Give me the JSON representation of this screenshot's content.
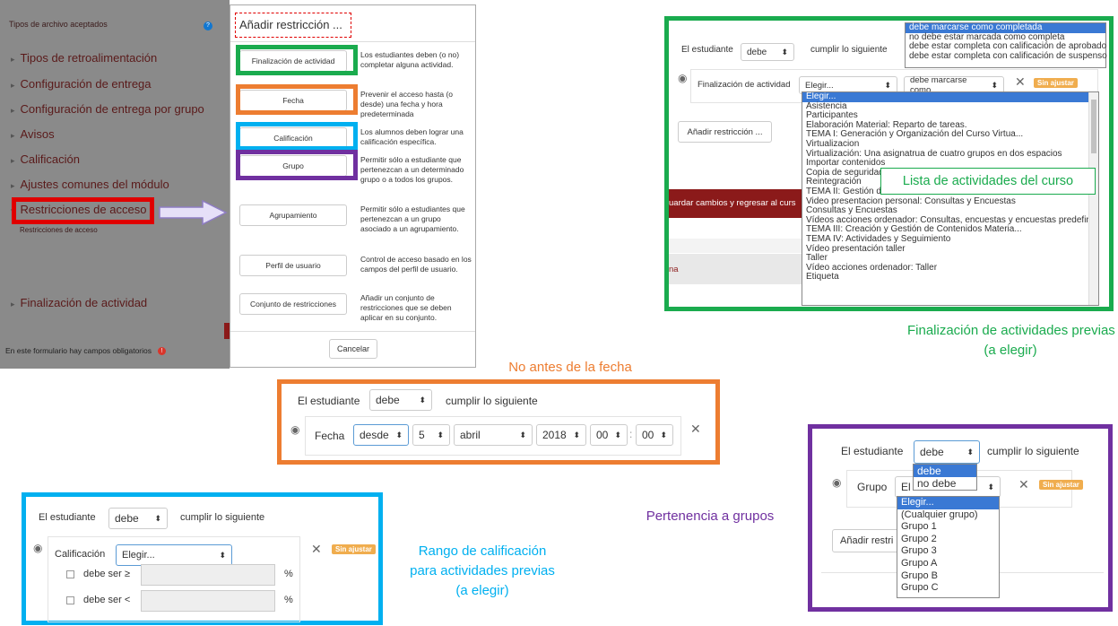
{
  "settings": {
    "tipos_label": "Tipos de archivo aceptados",
    "nav": [
      "Tipos de retroalimentación",
      "Configuración de entrega",
      "Configuración de entrega por grupo",
      "Avisos",
      "Calificación",
      "Ajustes comunes del módulo",
      "Restricciones de acceso",
      "Finalización de actividad"
    ],
    "sub_label": "Restricciones de acceso",
    "footer_note": "En este formulario hay campos obligatorios"
  },
  "modal": {
    "title": "Añadir restricción ...",
    "options": [
      {
        "label": "Finalización de actividad",
        "desc": "Los estudiantes deben (o no) completar alguna actividad."
      },
      {
        "label": "Fecha",
        "desc": "Prevenir el acceso hasta (o desde) una fecha y hora predeterminada"
      },
      {
        "label": "Calificación",
        "desc": "Los alumnos deben lograr una calificación específica."
      },
      {
        "label": "Grupo",
        "desc": "Permitir sólo a estudiante que pertenezcan a un determinado grupo o a todos los grupos."
      },
      {
        "label": "Agrupamiento",
        "desc": "Permitir sólo a estudiantes que pertenezcan a un grupo asociado a un agrupamiento."
      },
      {
        "label": "Perfil de usuario",
        "desc": "Control de acceso basado en los campos del perfil de usuario."
      },
      {
        "label": "Conjunto de restricciones",
        "desc": "Añadir un conjunto de restricciones que se deben aplicar en su conjunto."
      }
    ],
    "cancel": "Cancelar"
  },
  "completion": {
    "el_estudiante": "El estudiante",
    "debe": "debe",
    "cumplir": "cumplir lo siguiente",
    "row_label": "Finalización de actividad",
    "elegir": "Elegir...",
    "marcarse": "debe marcarse como",
    "sin_ajustar": "Sin ajustar",
    "add_btn": "Añadir restricción ...",
    "save_btn": "uardar cambios y regresar al curs",
    "stray": "na",
    "options": [
      "debe marcarse como completada",
      "no debe estar marcada como completa",
      "debe estar completa con calificación de aprobado",
      "debe estar completa con calificación de suspenso"
    ],
    "activities": [
      "Elegir...",
      "Asistencia",
      "Participantes",
      "Elaboración Material: Reparto de tareas.",
      "TEMA I: Generación y Organización del Curso Virtua...",
      "Virtualizacion",
      "Virtualización: Una asignatrua de cuatro grupos en dos espacios",
      "Importar contenidos",
      "Copia de seguridad",
      "Reintegración",
      "TEMA II: Gestión de Medios de Comunicación",
      "Video presentacion personal: Consultas y Encuestas",
      "Consultas y Encuestas",
      "Vídeos acciones ordenador: Consultas, encuestas y encuestas predefinidas",
      "TEMA III: Creación y Gestión de Contenidos Materia...",
      "TEMA IV: Actividades y Seguimiento",
      "Vídeo presentación taller",
      "Taller",
      "Vídeo acciones ordenador: Taller",
      "Etiqueta"
    ],
    "list_callout": "Lista de actividades del curso",
    "caption": [
      "Finalización de actividades previas",
      "(a elegir)"
    ]
  },
  "date": {
    "caption": "No antes de la fecha",
    "el_estudiante": "El estudiante",
    "debe": "debe",
    "cumplir": "cumplir lo siguiente",
    "label": "Fecha",
    "desde": "desde",
    "day": "5",
    "month": "abril",
    "year": "2018",
    "hour": "00",
    "minute": "00"
  },
  "grade": {
    "el_estudiante": "El estudiante",
    "debe": "debe",
    "cumplir": "cumplir lo siguiente",
    "label": "Calificación",
    "elegir": "Elegir...",
    "sin_ajustar": "Sin ajustar",
    "min_label": "debe ser ≥",
    "max_label": "debe ser <",
    "pct": "%",
    "caption": [
      "Rango de calificación",
      "para actividades previas",
      "(a elegir)"
    ]
  },
  "group": {
    "el_estudiante": "El estudiante",
    "debe": "debe",
    "cumplir": "cumplir lo siguiente",
    "label": "Grupo",
    "el_partial": "El",
    "no_debe": "no debe",
    "debe_opt": "debe",
    "sin_ajustar": "Sin ajustar",
    "add_btn": "Añadir restri",
    "groups": [
      "Elegir...",
      "(Cualquier grupo)",
      "Grupo 1",
      "Grupo 2",
      "Grupo 3",
      "Grupo A",
      "Grupo B",
      "Grupo C"
    ],
    "caption": "Pertenencia a grupos"
  },
  "colors": {
    "green": "#1aab4e",
    "orange": "#ed7d31",
    "blue": "#00b0f0",
    "purple": "#7030a0",
    "red": "#e00000"
  }
}
